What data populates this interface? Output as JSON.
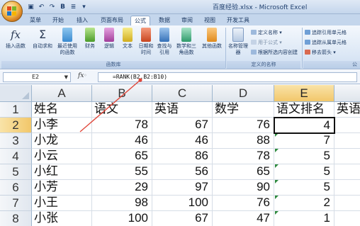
{
  "window": {
    "title": "百度经验.xlsx - Microsoft Excel"
  },
  "quick_access": [
    "save-icon",
    "undo-icon",
    "redo-icon",
    "bold-icon",
    "format-icon",
    "dropdown-icon"
  ],
  "tabs": [
    {
      "label": "菜单"
    },
    {
      "label": "开始"
    },
    {
      "label": "插入"
    },
    {
      "label": "页面布局"
    },
    {
      "label": "公式",
      "active": true
    },
    {
      "label": "数据"
    },
    {
      "label": "审阅"
    },
    {
      "label": "视图"
    },
    {
      "label": "开发工具"
    }
  ],
  "ribbon": {
    "insert_function": "插入函数",
    "autosum": "自动求和",
    "recent": "最近使用的函数",
    "financial": "财务",
    "logical": "逻辑",
    "text": "文本",
    "datetime": "日期和时间",
    "lookup": "查找与引用",
    "math": "数学和三角函数",
    "other": "其他函数",
    "group_library": "函数库",
    "name_manager": "名称管理器",
    "define_name": "定义名称",
    "use_in_formula": "用于公式",
    "create_from_selection": "根据所选内容创建",
    "group_names": "定义的名称",
    "trace_precedents": "追踪引用单元格",
    "trace_dependents": "追踪从属单元格",
    "remove_arrows": "移去箭头",
    "group_audit": "公"
  },
  "formula_bar": {
    "name_box": "E2",
    "fx_label": "fx",
    "formula": "=RANK(B2,B2:B10)"
  },
  "columns": [
    "A",
    "B",
    "C",
    "D",
    "E",
    ""
  ],
  "active_column": "E",
  "rows": [
    {
      "num": "1",
      "cells": [
        "姓名",
        "语文",
        "英语",
        "数学",
        "语文排名",
        "英语"
      ]
    },
    {
      "num": "2",
      "cells": [
        "小李",
        "78",
        "67",
        "76",
        "4",
        ""
      ]
    },
    {
      "num": "3",
      "cells": [
        "小龙",
        "46",
        "46",
        "88",
        "7",
        ""
      ]
    },
    {
      "num": "4",
      "cells": [
        "小云",
        "65",
        "86",
        "78",
        "5",
        ""
      ]
    },
    {
      "num": "5",
      "cells": [
        "小红",
        "55",
        "56",
        "65",
        "5",
        ""
      ]
    },
    {
      "num": "6",
      "cells": [
        "小芳",
        "29",
        "97",
        "90",
        "5",
        ""
      ]
    },
    {
      "num": "7",
      "cells": [
        "小王",
        "98",
        "100",
        "76",
        "2",
        ""
      ]
    },
    {
      "num": "8",
      "cells": [
        "小张",
        "100",
        "67",
        "47",
        "1",
        ""
      ]
    }
  ],
  "active_cell": "E2",
  "colors": {
    "annotation_arrow": "#e0473a",
    "accent": "#f2c76a"
  }
}
